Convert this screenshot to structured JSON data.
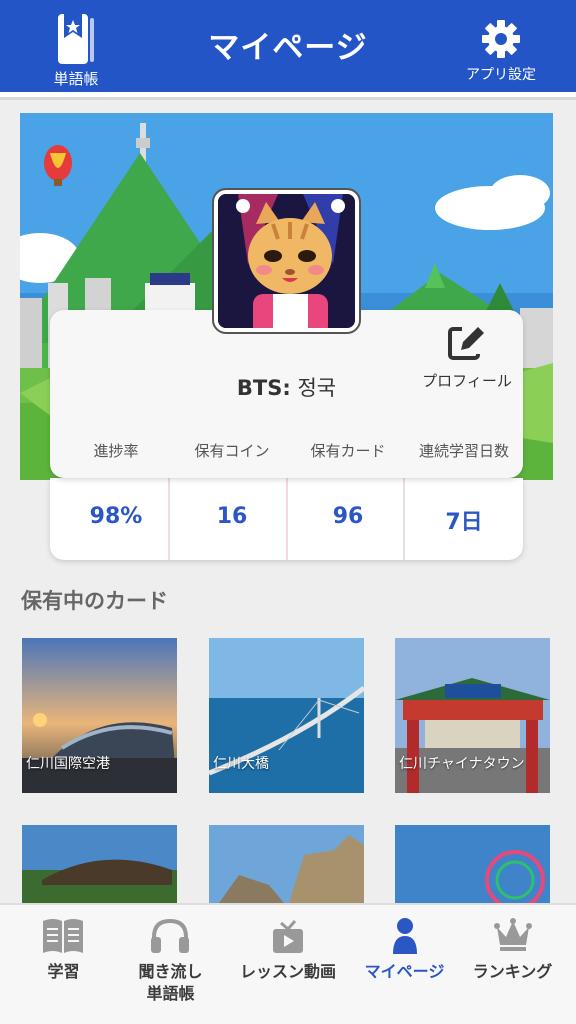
{
  "header": {
    "title": "マイページ",
    "vocab_label": "単語帳",
    "settings_label": "アプリ設定",
    "bg_color": "#2355c7"
  },
  "profile": {
    "name_prefix": "BTS:",
    "name": "정국",
    "edit_label": "プロフィール"
  },
  "stats": [
    {
      "label": "進捗率",
      "value": "98%"
    },
    {
      "label": "保有コイン",
      "value": "16"
    },
    {
      "label": "保有カード",
      "value": "96"
    },
    {
      "label": "連続学習日数",
      "value": "7日"
    }
  ],
  "cards_section": {
    "title": "保有中のカード",
    "cards": [
      {
        "label": "仁川国際空港"
      },
      {
        "label": "仁川大橋"
      },
      {
        "label": "仁川チャイナタウン"
      },
      {
        "label": ""
      },
      {
        "label": ""
      },
      {
        "label": ""
      }
    ]
  },
  "nav": [
    {
      "label": "学習",
      "icon": "book-icon"
    },
    {
      "label": "聞き流し\n単語帳",
      "icon": "headphones-icon"
    },
    {
      "label": "レッスン動画",
      "icon": "tv-icon"
    },
    {
      "label": "マイページ",
      "icon": "person-icon",
      "active": true
    },
    {
      "label": "ランキング",
      "icon": "crown-icon"
    }
  ],
  "colors": {
    "accent": "#2b57c4",
    "active_nav": "#2b57c4"
  }
}
